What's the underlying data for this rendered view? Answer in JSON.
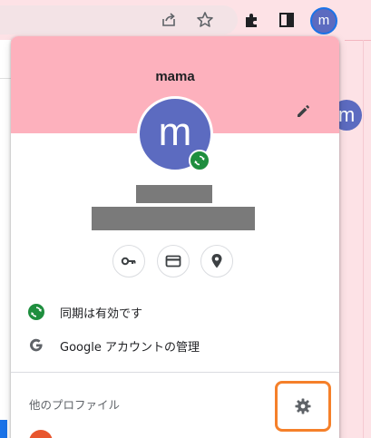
{
  "browser": {
    "profile_initial": "m",
    "icons": [
      "share-icon",
      "star-icon",
      "extensions-icon",
      "side-panel-icon"
    ],
    "background_avatar_initial": "m"
  },
  "popup": {
    "profile_name": "mama",
    "avatar_initial": "m",
    "header_color": "#fdb1bd",
    "avatar_color": "#5c6bc0",
    "sync_color": "#1e8e3e",
    "quick_actions": [
      "key-icon",
      "credit-card-icon",
      "location-pin-icon"
    ],
    "sync_status": "同期は有効です",
    "manage_account": "Google アカウントの管理",
    "other_profiles_label": "他のプロファイル",
    "highlight_color": "#f5802a"
  }
}
